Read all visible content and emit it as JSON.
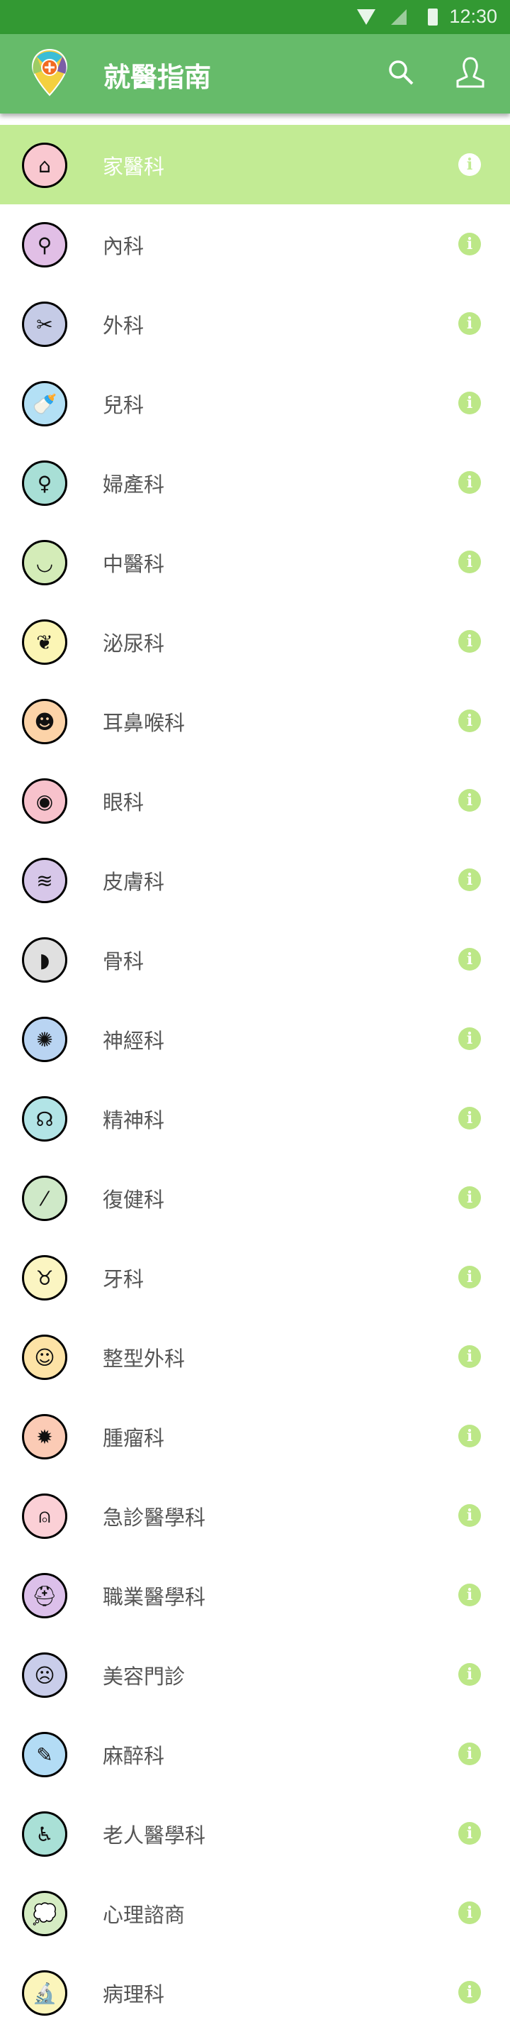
{
  "status_bar": {
    "time": "12:30",
    "icons": [
      "wifi-icon",
      "signal-icon",
      "battery-icon"
    ]
  },
  "header": {
    "title": "就醫指南",
    "logo": "map-pin-medical-logo",
    "actions": [
      "search-icon",
      "user-icon"
    ]
  },
  "colors": {
    "status_bar": "#339933",
    "header": "#66bb6a",
    "active_row": "#c2eb94",
    "info": "#bce787"
  },
  "departments": [
    {
      "label": "家醫科",
      "icon": "house-stethoscope-icon",
      "color": "#f9c8d0",
      "glyph": "⌂",
      "active": true
    },
    {
      "label": "內科",
      "icon": "magnifier-body-icon",
      "color": "#e1bfe6",
      "glyph": "⚲"
    },
    {
      "label": "外科",
      "icon": "scissors-scalpel-icon",
      "color": "#c5cbe6",
      "glyph": "✂"
    },
    {
      "label": "兒科",
      "icon": "baby-bottle-icon",
      "color": "#b3e0f5",
      "glyph": "🍼"
    },
    {
      "label": "婦產科",
      "icon": "uterus-icon",
      "color": "#a8dfd6",
      "glyph": "♀"
    },
    {
      "label": "中醫科",
      "icon": "mortar-pestle-icon",
      "color": "#d4ecb8",
      "glyph": "◡"
    },
    {
      "label": "泌尿科",
      "icon": "kidney-icon",
      "color": "#fbf5b5",
      "glyph": "❦"
    },
    {
      "label": "耳鼻喉科",
      "icon": "head-profile-icon",
      "color": "#fcd3a8",
      "glyph": "☻"
    },
    {
      "label": "眼科",
      "icon": "eye-icon",
      "color": "#f7c2cc",
      "glyph": "◉"
    },
    {
      "label": "皮膚科",
      "icon": "skin-hair-icon",
      "color": "#d7c7e9",
      "glyph": "≋"
    },
    {
      "label": "骨科",
      "icon": "bone-joint-icon",
      "color": "#e0e0e0",
      "glyph": "◗"
    },
    {
      "label": "神經科",
      "icon": "neuron-icon",
      "color": "#b9d4f2",
      "glyph": "✺"
    },
    {
      "label": "精神科",
      "icon": "head-speech-icon",
      "color": "#b2e4e6",
      "glyph": "☊"
    },
    {
      "label": "復健科",
      "icon": "syringe-icon",
      "color": "#cfe9c8",
      "glyph": "⁄"
    },
    {
      "label": "牙科",
      "icon": "tooth-icon",
      "color": "#fbf5c2",
      "glyph": "♉"
    },
    {
      "label": "整型外科",
      "icon": "face-marked-icon",
      "color": "#fde3a6",
      "glyph": "☺"
    },
    {
      "label": "腫瘤科",
      "icon": "tumor-cell-icon",
      "color": "#fbcbb5",
      "glyph": "✹"
    },
    {
      "label": "急診醫學科",
      "icon": "siren-icon",
      "color": "#fbd0d6",
      "glyph": "⍝"
    },
    {
      "label": "職業醫學科",
      "icon": "worker-helmet-icon",
      "color": "#dcc0ea",
      "glyph": "⛑"
    },
    {
      "label": "美容門診",
      "icon": "face-mask-icon",
      "color": "#c9cdea",
      "glyph": "☹"
    },
    {
      "label": "麻醉科",
      "icon": "injection-icon",
      "color": "#b3dcf5",
      "glyph": "✎"
    },
    {
      "label": "老人醫學科",
      "icon": "elderly-cane-icon",
      "color": "#a9e0d6",
      "glyph": "♿"
    },
    {
      "label": "心理諮商",
      "icon": "head-thought-icon",
      "color": "#d5ecc3",
      "glyph": "💭"
    },
    {
      "label": "病理科",
      "icon": "microscope-icon",
      "color": "#fbf5bb",
      "glyph": "🔬"
    }
  ],
  "info_glyph": "i"
}
